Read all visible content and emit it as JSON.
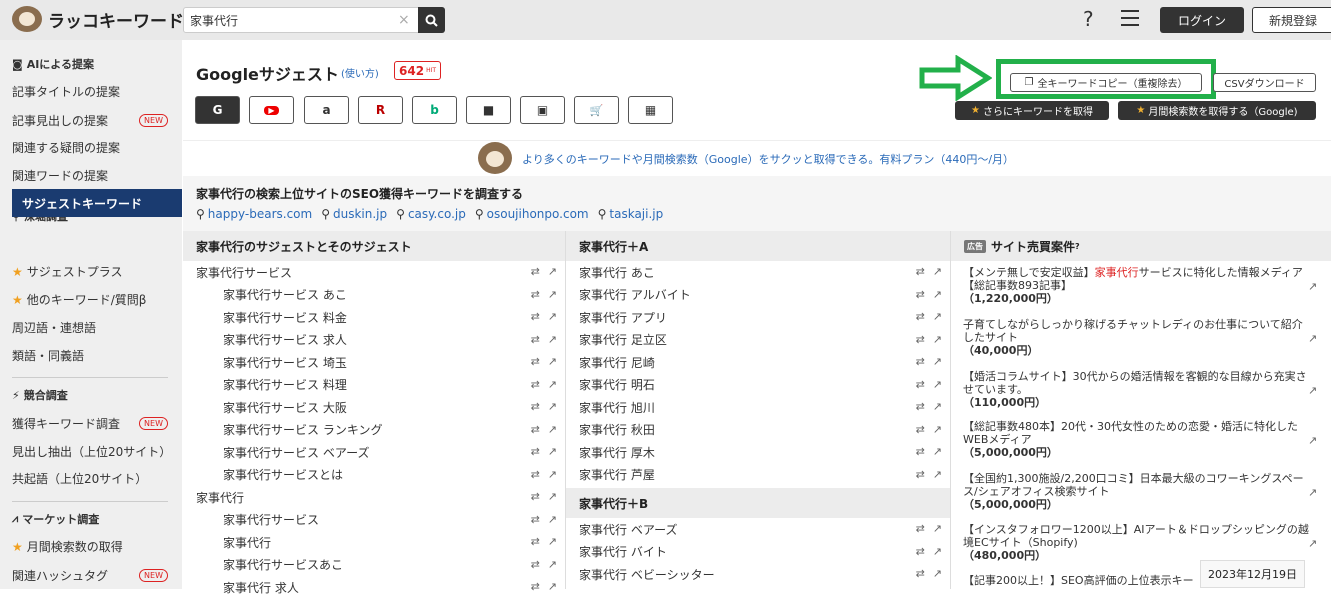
{
  "brand": {
    "name": "ラッコキーワード"
  },
  "search": {
    "value": "家事代行",
    "clear": "×",
    "button_icon": "search-icon"
  },
  "header": {
    "help": "?",
    "login": "ログイン",
    "signup": "新規登録"
  },
  "sidebar": {
    "sections": [
      {
        "title": "AIによる提案",
        "icon": "robot-icon"
      },
      {
        "title": "深堀調査",
        "icon": "search-icon"
      },
      {
        "title": "競合調査",
        "icon": "bolt-icon"
      },
      {
        "title": "マーケット調査",
        "icon": "chart-icon"
      }
    ],
    "items": [
      {
        "label": "記事タイトルの提案"
      },
      {
        "label": "記事見出しの提案",
        "badge": "NEW"
      },
      {
        "label": "関連する疑問の提案"
      },
      {
        "label": "関連ワードの提案"
      },
      {
        "label": "サジェストキーワード"
      },
      {
        "label": "サジェストプラス"
      },
      {
        "label": "他のキーワード/質問β"
      },
      {
        "label": "周辺語・連想語"
      },
      {
        "label": "類語・同義語"
      },
      {
        "label": "獲得キーワード調査",
        "badge": "NEW"
      },
      {
        "label": "見出し抽出（上位20サイト）"
      },
      {
        "label": "共起語（上位20サイト）"
      },
      {
        "label": "月間検索数の取得"
      },
      {
        "label": "関連ハッシュタグ",
        "badge": "NEW"
      }
    ]
  },
  "main": {
    "title": "Googleサジェスト",
    "howto": "(使い方)",
    "hit_count": "642",
    "hit_unit": "HIT",
    "engines": [
      {
        "name": "google",
        "label": "G",
        "icon": "google-icon"
      },
      {
        "name": "youtube",
        "label": "▶",
        "icon": "youtube-icon"
      },
      {
        "name": "amazon",
        "label": "a",
        "icon": "amazon-icon"
      },
      {
        "name": "rakuten",
        "label": "R",
        "icon": "rakuten-icon"
      },
      {
        "name": "bing",
        "label": "b",
        "icon": "bing-icon"
      },
      {
        "name": "video",
        "label": "■",
        "icon": "video-icon"
      },
      {
        "name": "image",
        "label": "▣",
        "icon": "image-icon"
      },
      {
        "name": "shopping",
        "label": "🛒",
        "icon": "cart-icon"
      },
      {
        "name": "app",
        "label": "▦",
        "icon": "grid-icon"
      }
    ],
    "copy_all": "全キーワードコピー（重複除去）",
    "csv": "CSVダウンロード",
    "more_keywords": "さらにキーワードを取得",
    "monthly_volume": "月間検索数を取得する（Google)",
    "promo": "より多くのキーワードや月間検索数（Google）をサクッと取得できる。有料プラン（440円〜/月）",
    "seo_title": "家事代行の検索上位サイトのSEO獲得キーワードを調査する",
    "seo_sites": [
      "happy-bears.com",
      "duskin.jp",
      "casy.co.jp",
      "osoujihonpo.com",
      "taskaji.jp"
    ]
  },
  "columns": {
    "col1": {
      "header": "家事代行のサジェストとそのサジェスト",
      "items": [
        {
          "text": "家事代行サービス",
          "indent": false
        },
        {
          "text": "家事代行サービス あこ",
          "indent": true
        },
        {
          "text": "家事代行サービス 料金",
          "indent": true
        },
        {
          "text": "家事代行サービス 求人",
          "indent": true
        },
        {
          "text": "家事代行サービス 埼玉",
          "indent": true
        },
        {
          "text": "家事代行サービス 料理",
          "indent": true
        },
        {
          "text": "家事代行サービス 大阪",
          "indent": true
        },
        {
          "text": "家事代行サービス ランキング",
          "indent": true
        },
        {
          "text": "家事代行サービス ベアーズ",
          "indent": true
        },
        {
          "text": "家事代行サービスとは",
          "indent": true
        },
        {
          "text": "家事代行",
          "indent": false
        },
        {
          "text": "家事代行サービス",
          "indent": true
        },
        {
          "text": "家事代行",
          "indent": true
        },
        {
          "text": "家事代行サービスあこ",
          "indent": true
        },
        {
          "text": "家事代行 求人",
          "indent": true
        }
      ]
    },
    "col2": {
      "header": "家事代行＋A",
      "items": [
        "家事代行 あこ",
        "家事代行 アルバイト",
        "家事代行 アプリ",
        "家事代行 足立区",
        "家事代行 尼崎",
        "家事代行 明石",
        "家事代行 旭川",
        "家事代行 秋田",
        "家事代行 厚木",
        "家事代行 芦屋"
      ],
      "header2": "家事代行＋B",
      "items2": [
        "家事代行 ベアーズ",
        "家事代行 バイト",
        "家事代行 ベビーシッター"
      ]
    },
    "col3": {
      "ad_badge": "広告",
      "header": "サイト売買案件",
      "help": "?",
      "ads": [
        {
          "pre": "【メンテ無しで安定収益】",
          "hl": "家事代行",
          "post": "サービスに特化した情報メディア【総記事数893記事】",
          "price": "（1,220,000円）"
        },
        {
          "pre": "子育てしながらしっかり稼げるチャットレディのお仕事について紹介したサイト",
          "hl": "",
          "post": "",
          "price": "（40,000円）"
        },
        {
          "pre": "【婚活コラムサイト】30代からの婚活情報を客観的な目線から充実させています。",
          "hl": "",
          "post": "",
          "price": "（110,000円）"
        },
        {
          "pre": "【総記事数480本】20代・30代女性のための恋愛・婚活に特化したWEBメディア",
          "hl": "",
          "post": "",
          "price": "（5,000,000円）"
        },
        {
          "pre": "【全国約1,300施設/2,200口コミ】日本最大級のコワーキングスペース/シェアオフィス検索サイト",
          "hl": "",
          "post": "",
          "price": "（5,000,000円）"
        },
        {
          "pre": "【インスタフォロワー1200以上】AIアート＆ドロップシッピングの越境ECサイト（Shopify)",
          "hl": "",
          "post": "",
          "price": "（480,000円）"
        },
        {
          "pre": "【記事200以上！】SEO高評価の上位表示キー",
          "hl": "",
          "post": "",
          "price": ""
        }
      ]
    }
  },
  "date": "2023年12月19日",
  "colors": {
    "accent": "#1a3b70",
    "highlight": "#22b04a",
    "badge_red": "#dd2222",
    "link": "#2a6ab8"
  }
}
